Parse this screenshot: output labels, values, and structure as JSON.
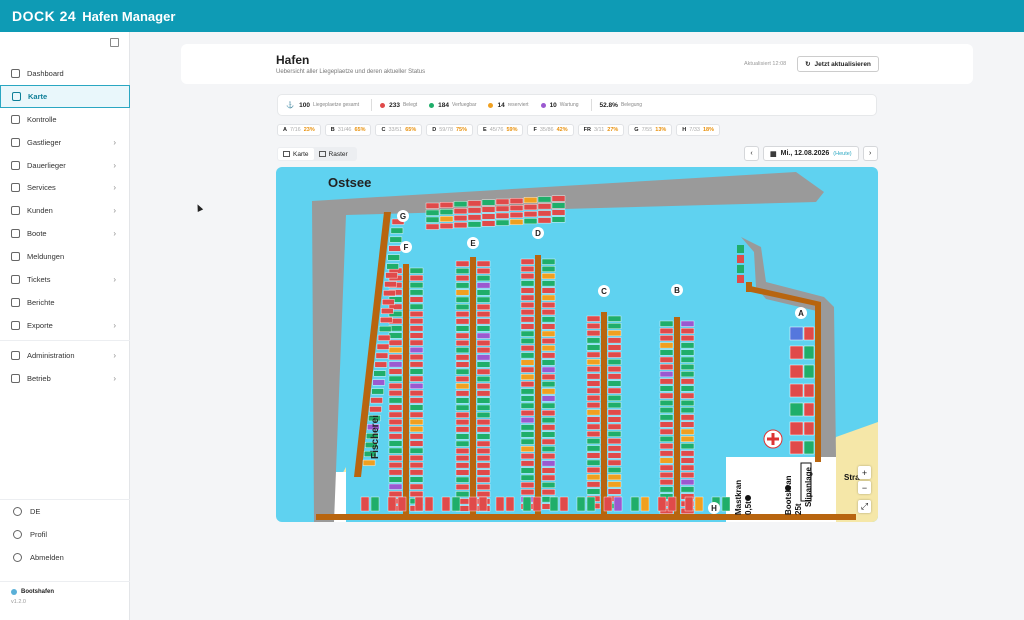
{
  "app": {
    "logo": "DOCK 24",
    "title": "Hafen Manager"
  },
  "sidebar": {
    "items": [
      {
        "label": "Dashboard",
        "icon": "dashboard-icon",
        "chev": false
      },
      {
        "label": "Karte",
        "icon": "map-icon",
        "chev": false,
        "active": true
      },
      {
        "label": "Kontrolle",
        "icon": "clipboard-icon",
        "chev": false
      },
      {
        "label": "Gastlieger",
        "icon": "calendar-icon",
        "chev": true
      },
      {
        "label": "Dauerlieger",
        "icon": "anchor-icon",
        "chev": true
      },
      {
        "label": "Services",
        "icon": "services-icon",
        "chev": true
      },
      {
        "label": "Kunden",
        "icon": "users-icon",
        "chev": true
      },
      {
        "label": "Boote",
        "icon": "boat-icon",
        "chev": true
      },
      {
        "label": "Meldungen",
        "icon": "bell-icon",
        "chev": false
      },
      {
        "label": "Tickets",
        "icon": "ticket-icon",
        "chev": true
      },
      {
        "label": "Berichte",
        "icon": "chart-icon",
        "chev": false
      },
      {
        "label": "Exporte",
        "icon": "export-icon",
        "chev": true
      }
    ],
    "admin_items": [
      {
        "label": "Administration",
        "icon": "gear-icon",
        "chev": true
      },
      {
        "label": "Betrieb",
        "icon": "wrench-icon",
        "chev": true
      }
    ],
    "bottom": {
      "language": "DE",
      "profile": "Profil",
      "logout": "Abmelden"
    },
    "footer": {
      "name": "Bootshafen",
      "version": "v1.2.0"
    }
  },
  "header": {
    "title": "Hafen",
    "subtitle": "Uebersicht aller Liegeplaetze und deren aktueller Status",
    "updated": "Aktualisiert 12:08",
    "refresh_label": "Jetzt aktualisieren"
  },
  "stats": {
    "total": "100",
    "total_label": "Liegeplaetze gesamt",
    "occupied": "233",
    "occupied_label": "Belegt",
    "free": "184",
    "free_label": "Verfuegbar",
    "reserved": "14",
    "reserved_label": "reserviert",
    "maint": "10",
    "maint_label": "Wartung",
    "rate": "52.8%",
    "rate_label": "Belegung",
    "colors": {
      "occupied": "#e04a4a",
      "free": "#1fae6a",
      "reserved": "#f0a020",
      "maint": "#9b59d0"
    }
  },
  "piers": [
    {
      "k": "A",
      "m": "7/16",
      "p": "23%"
    },
    {
      "k": "B",
      "m": "31/46",
      "p": "65%"
    },
    {
      "k": "C",
      "m": "33/51",
      "p": "65%"
    },
    {
      "k": "D",
      "m": "59/78",
      "p": "75%"
    },
    {
      "k": "E",
      "m": "45/76",
      "p": "59%"
    },
    {
      "k": "F",
      "m": "35/86",
      "p": "42%"
    },
    {
      "k": "FR",
      "m": "3/11",
      "p": "27%"
    },
    {
      "k": "G",
      "m": "7/55",
      "p": "13%"
    },
    {
      "k": "H",
      "m": "7/33",
      "p": "18%"
    }
  ],
  "view": {
    "map": "Karte",
    "grid": "Raster"
  },
  "datenav": {
    "date": "Mi., 12.08.2026",
    "today": "(Heute)"
  },
  "map": {
    "sea": "Ostsee",
    "labels": [
      "A",
      "B",
      "C",
      "D",
      "E",
      "F",
      "G",
      "H"
    ],
    "fischerei": "Fischerei",
    "mastkran": "Mastkran 0,5t",
    "bootskran": "Bootskran 25t",
    "slipanlage": "Slipanlage",
    "strand": "Stra"
  }
}
